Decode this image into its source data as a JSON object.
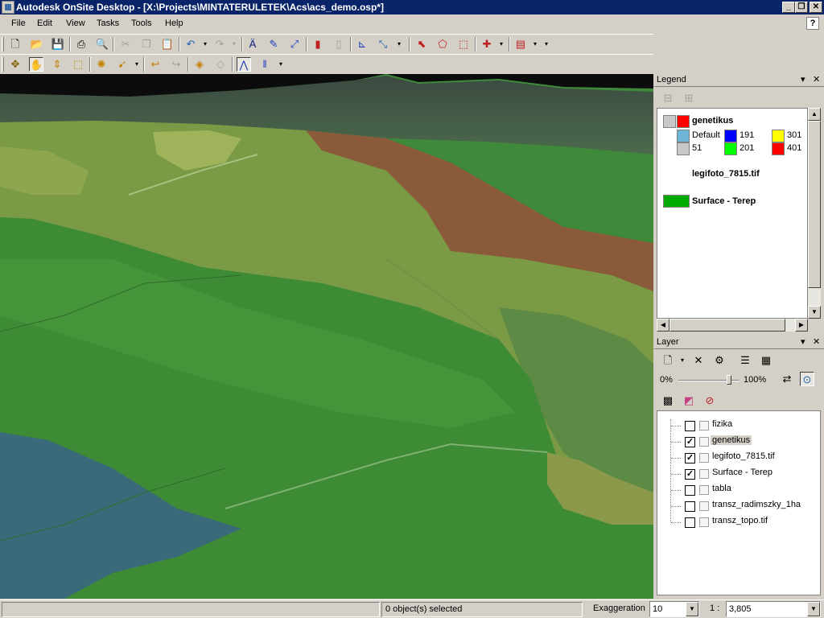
{
  "window": {
    "title": "Autodesk OnSite Desktop - [X:\\Projects\\MINTATERULETEK\\Acs\\acs_demo.osp*]",
    "min": "_",
    "max": "❐",
    "close": "✕"
  },
  "menu": {
    "items": [
      "File",
      "Edit",
      "View",
      "Tasks",
      "Tools",
      "Help"
    ],
    "help_icon": "?"
  },
  "legend": {
    "title": "Legend",
    "groups": [
      {
        "name": "genetikus"
      },
      {
        "name": "legifoto_7815.tif"
      },
      {
        "name": "Surface - Terep"
      }
    ],
    "classes": [
      {
        "label": "Default",
        "color": "#6fb5d8"
      },
      {
        "label": "191",
        "color": "#0000ff"
      },
      {
        "label": "301",
        "color": "#ffff00"
      },
      {
        "label": "51",
        "color": "#c8c8c8"
      },
      {
        "label": "201",
        "color": "#00ff00"
      },
      {
        "label": "401",
        "color": "#ff0000"
      }
    ],
    "surface_color": "#00aa00"
  },
  "layer": {
    "title": "Layer",
    "transparency_min": "0%",
    "transparency_max": "100%",
    "items": [
      {
        "name": "fizika",
        "checked": false
      },
      {
        "name": "genetikus",
        "checked": true
      },
      {
        "name": "legifoto_7815.tif",
        "checked": true
      },
      {
        "name": "Surface - Terep",
        "checked": true
      },
      {
        "name": "tabla",
        "checked": false
      },
      {
        "name": "transz_radimszky_1ha",
        "checked": false
      },
      {
        "name": "transz_topo.tif",
        "checked": false
      }
    ]
  },
  "status": {
    "selection": "0 object(s) selected",
    "exaggeration_label": "Exaggeration",
    "exaggeration_value": "10",
    "scale_label": "1 :",
    "scale_value": "3,805"
  }
}
